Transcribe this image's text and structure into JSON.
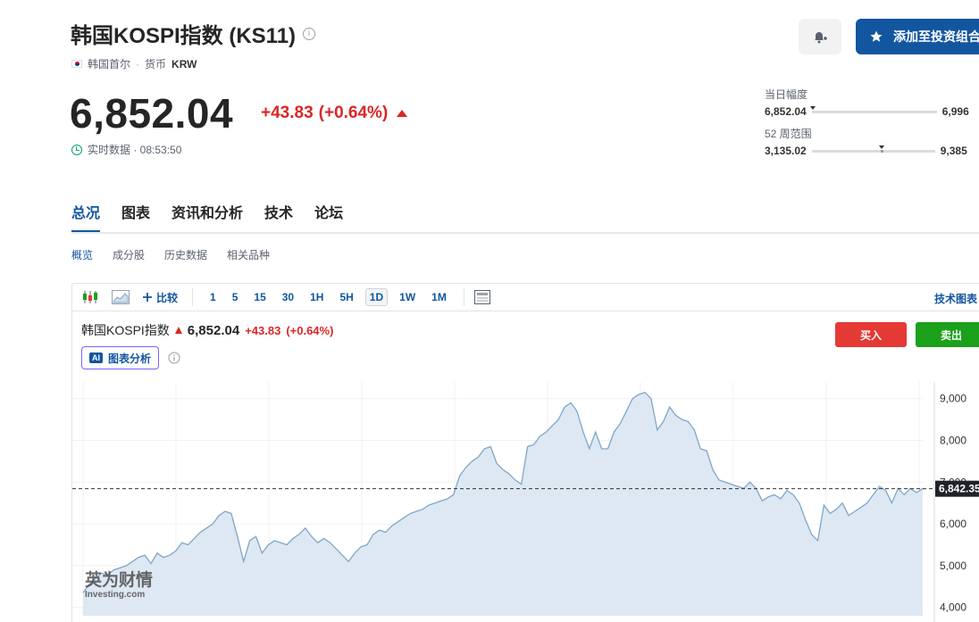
{
  "header": {
    "title": "韩国KOSPI指数 (KS11)",
    "info_glyph": "i",
    "country": "韩国首尔",
    "currency_label": "货币",
    "currency": "KRW",
    "add_portfolio": "添加至投资组合"
  },
  "quote": {
    "price": "6,852.04",
    "change": "+43.83",
    "change_pct": "(+0.64%)",
    "realtime": "实时数据 · 08:53:50"
  },
  "ranges": {
    "day": {
      "label": "当日幅度",
      "low": "6,852.04",
      "high": "6,996",
      "position": 0.01
    },
    "week52": {
      "label": "52 周范围",
      "low": "3,135.02",
      "high": "9,385",
      "position": 0.57
    }
  },
  "tabs": [
    {
      "label": "总况",
      "active": true
    },
    {
      "label": "图表"
    },
    {
      "label": "资讯和分析"
    },
    {
      "label": "技术"
    },
    {
      "label": "论坛"
    }
  ],
  "subtabs": [
    {
      "label": "概览",
      "active": true
    },
    {
      "label": "成分股"
    },
    {
      "label": "历史数据"
    },
    {
      "label": "相关品种"
    }
  ],
  "toolbar": {
    "compare": "比较",
    "intervals": [
      "1",
      "5",
      "15",
      "30",
      "1H",
      "5H",
      "1D",
      "1W",
      "1M"
    ],
    "active_interval": "1D",
    "tech_chart": "技术图表"
  },
  "chart_header": {
    "name": "韩国KOSPI指数",
    "price": "6,852.04",
    "change": "+43.83",
    "change_pct": "(+0.64%)",
    "ai_badge": "AI",
    "ai_label": "图表分析",
    "buy": "买入",
    "sell": "卖出"
  },
  "watermark": {
    "cn": "英为财情",
    "en": "Investing.com"
  },
  "colors": {
    "brand": "#1256a0",
    "up": "#dc2626",
    "buy": "#e53935",
    "sell": "#1ca11c",
    "area_fill": "#dde8f3",
    "area_line": "#7fa6c9"
  },
  "chart_data": {
    "type": "area",
    "ylim": [
      3800,
      9400
    ],
    "yticks": [
      4000,
      5000,
      6000,
      7000,
      8000,
      9000
    ],
    "ytick_labels": [
      "4,000",
      "5,000",
      "6,000",
      "7,000",
      "8,000",
      "9,000"
    ],
    "current_value": 6842.35,
    "current_label": "6,842.35",
    "grid": true,
    "values": [
      4350,
      4550,
      4700,
      4820,
      4780,
      4900,
      4950,
      5000,
      5100,
      5200,
      5250,
      5050,
      5300,
      5200,
      5250,
      5350,
      5550,
      5500,
      5650,
      5800,
      5900,
      6000,
      6200,
      6300,
      6250,
      5700,
      5100,
      5600,
      5700,
      5300,
      5500,
      5600,
      5550,
      5500,
      5650,
      5750,
      5900,
      5700,
      5550,
      5650,
      5550,
      5400,
      5250,
      5100,
      5300,
      5450,
      5500,
      5750,
      5850,
      5800,
      5950,
      6050,
      6150,
      6250,
      6300,
      6350,
      6450,
      6500,
      6550,
      6600,
      6700,
      7150,
      7350,
      7500,
      7600,
      7800,
      7850,
      7450,
      7300,
      7200,
      7050,
      6950,
      7850,
      7900,
      8100,
      8200,
      8350,
      8500,
      8800,
      8900,
      8700,
      8200,
      7800,
      8200,
      7800,
      7800,
      8200,
      8400,
      8700,
      9000,
      9100,
      9150,
      9000,
      8250,
      8450,
      8800,
      8600,
      8500,
      8450,
      8250,
      7800,
      7750,
      7300,
      7050,
      7000,
      6950,
      6900,
      6850,
      7000,
      6850,
      6550,
      6650,
      6700,
      6600,
      6800,
      6700,
      6500,
      6100,
      5750,
      5600,
      6450,
      6250,
      6350,
      6500,
      6200,
      6300,
      6400,
      6500,
      6700,
      6900,
      6800,
      6500,
      6850,
      6700,
      6850,
      6750,
      6850
    ]
  }
}
